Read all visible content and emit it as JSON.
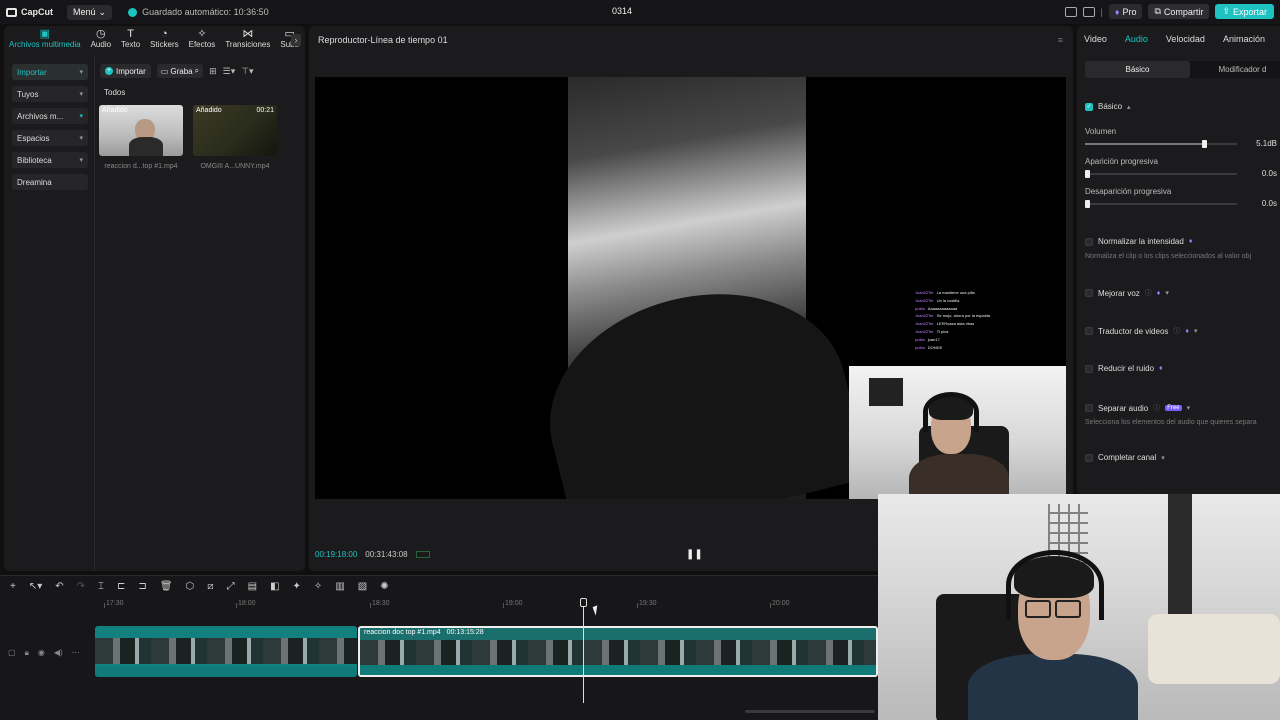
{
  "app": {
    "logo_text": "CapCut",
    "menu_label": "Menú",
    "autosave_text": "Guardado automático: 10:36:50",
    "project_title": "0314",
    "pro_label": "Pro",
    "share_label": "Compartir",
    "export_label": "Exportar"
  },
  "toolbar": {
    "tabs": [
      {
        "label": "Archivos multimedia",
        "icon": "media-icon"
      },
      {
        "label": "Audio",
        "icon": "audio-icon"
      },
      {
        "label": "Texto",
        "icon": "text-icon"
      },
      {
        "label": "Stickers",
        "icon": "sticker-icon"
      },
      {
        "label": "Efectos",
        "icon": "effects-icon"
      },
      {
        "label": "Transiciones",
        "icon": "transitions-icon"
      },
      {
        "label": "Subtí",
        "icon": "subtitles-icon"
      }
    ]
  },
  "sidebar": {
    "items": [
      {
        "label": "Importar"
      },
      {
        "label": "Tuyos"
      },
      {
        "label": "Archivos m..."
      },
      {
        "label": "Espacios"
      },
      {
        "label": "Biblioteca"
      },
      {
        "label": "Dreamina"
      }
    ]
  },
  "media": {
    "import_label": "Importar",
    "record_label": "Graba",
    "filter_label": "Todos",
    "items": [
      {
        "badge": "Añadido",
        "duration": "",
        "name": "reaccion d...top #1.mp4"
      },
      {
        "badge": "Añadido",
        "duration": "00:21",
        "name": "OMGIII A...UNNY.mp4"
      }
    ]
  },
  "player": {
    "title": "Reproductor-Línea de tiempo 01",
    "current_time": "00:19:18:00",
    "total_time": "00:31:43:08",
    "chat": [
      {
        "user": "Juan22Ter",
        "msg": "La mantiene una pilla"
      },
      {
        "user": "Juan22Ter",
        "msg": "Un la costilla"
      },
      {
        "user": "putita",
        "msg": "Aaaaaaaaaaaaa"
      },
      {
        "user": "Juan22Ter",
        "msg": "Se mojo, ahora por la espalda"
      },
      {
        "user": "Juan22Ter",
        "msg": "LEERoasa asta ribas"
      },
      {
        "user": "Juan22Ter",
        "msg": "Ti pica"
      },
      {
        "user": "putita",
        "msg": "juan17"
      },
      {
        "user": "putita",
        "msg": "DONDE"
      }
    ]
  },
  "inspector": {
    "tabs": [
      "Video",
      "Audio",
      "Velocidad",
      "Animación"
    ],
    "active_tab": "Audio",
    "segments": [
      "Básico",
      "Modificador d"
    ],
    "basic_label": "Básico",
    "params": [
      {
        "label": "Volumen",
        "value": "5.1dB",
        "level": 0.78
      },
      {
        "label": "Aparición progresiva",
        "value": "0.0s",
        "level": 0
      },
      {
        "label": "Desaparición progresiva",
        "value": "0.0s",
        "level": 0
      }
    ],
    "normalize": {
      "label": "Normalizar la intensidad",
      "desc": "Normaliza el clip o los clips seleccionados al valor obj"
    },
    "enhance_label": "Mejorar voz",
    "translate_label": "Traductor de videos",
    "denoise_label": "Reducir el ruido",
    "separate": {
      "label": "Separar audio",
      "badge": "Free",
      "desc": "Selecciona los elementos del audio que quieres separa"
    },
    "channel_label": "Completar canal"
  },
  "timeline": {
    "ruler": [
      "17:30",
      "18:00",
      "18:30",
      "19:00",
      "19:30",
      "20:00"
    ],
    "clip_name": "reaccion doc top #1.mp4",
    "clip_duration": "00:13:15:28"
  },
  "colors": {
    "accent": "#1ec2c0",
    "pro": "#9d7cff",
    "clip": "#11807e"
  }
}
